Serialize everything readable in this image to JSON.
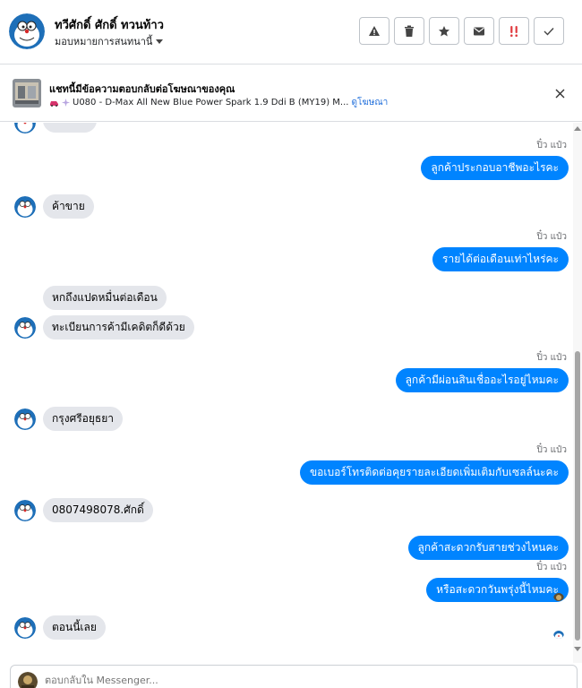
{
  "header": {
    "contact_name": "ทวีศักดิ์ ศักดิ์ ทวนท้าว",
    "assign_label": "มอบหมายการสนทนานี้",
    "tools": [
      "spam-icon",
      "trash-icon",
      "star-icon",
      "mail-icon",
      "follow-up-icon",
      "done-icon"
    ]
  },
  "ad": {
    "title": "แชทนี้มีข้อความตอบกลับต่อโฆษณาของคุณ",
    "subtitle": "U080 - D-Max All New Blue Power Spark 1.9 Ddi B (MY19) M...",
    "link": "ดูโฆษณา"
  },
  "messages": {
    "m1": {
      "sender": "ปิ๋ว แป๋ว",
      "text": "ลูกค้าประกอบอาชีพอะไรคะ"
    },
    "m2": {
      "text": "ค้าขาย"
    },
    "m3": {
      "sender": "ปิ๋ว แป๋ว",
      "text": "รายได้ต่อเดือนเท่าไหร่คะ"
    },
    "m4": {
      "text": "หกถึงแปดหมื่นต่อเดือน"
    },
    "m5": {
      "text": "ทะเบียนการค้ามีเคดิตก็ดีด้วย"
    },
    "m6": {
      "sender": "ปิ๋ว แป๋ว",
      "text": "ลูกค้ามีผ่อนสินเชื่ออะไรอยู่ไหมคะ"
    },
    "m7": {
      "text": "กรุงศรีอยุธยา"
    },
    "m8": {
      "sender": "ปิ๋ว แป๋ว",
      "text": "ขอเบอร์โทรติดต่อคุยรายละเอียดเพิ่มเติมกับเซลล์นะคะ"
    },
    "m9": {
      "text": "0807498078.ศักดิ์"
    },
    "m10": {
      "sender": "ปิ๋ว แป๋ว",
      "text": "ลูกค้าสะดวกรับสายช่วงไหนคะ"
    },
    "m11": {
      "sender": "ปิ๋ว แป๋ว",
      "text": "หรือสะดวกวันพรุ่งนี้ไหมคะ"
    },
    "m12": {
      "text": "ตอนนี้เลย"
    }
  },
  "composer": {
    "placeholder": "ตอบกลับใน Messenger..."
  },
  "colors": {
    "outgoing_bubble": "#0084ff",
    "incoming_bubble": "#e4e6eb",
    "link": "#216fdb"
  }
}
